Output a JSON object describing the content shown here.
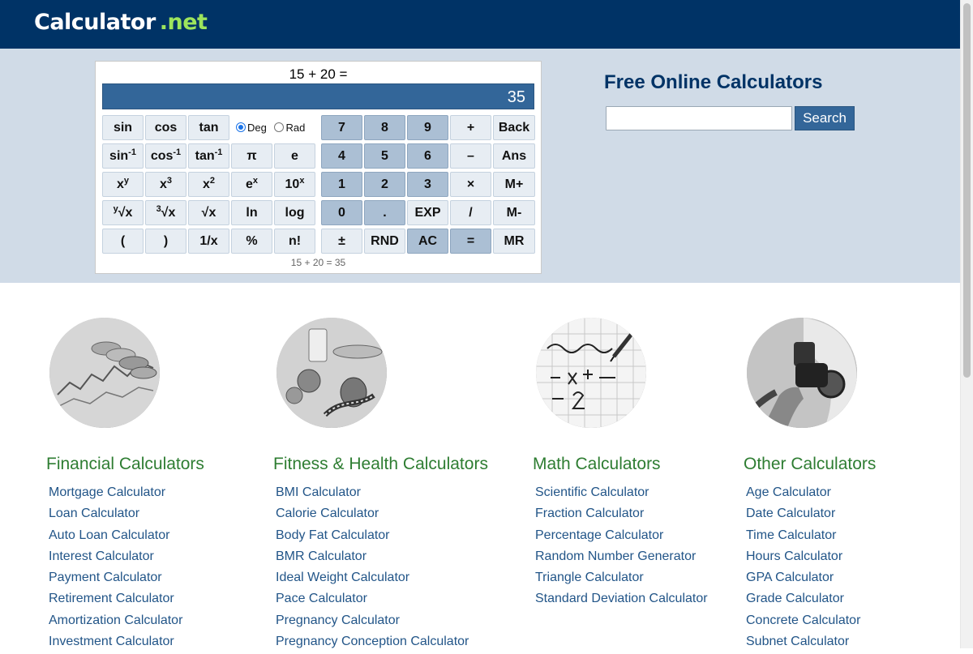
{
  "logo": {
    "main": "Calculator",
    "net": ".net"
  },
  "calculator": {
    "expression": "15 + 20 =",
    "display": "35",
    "history": "15 + 20 = 35",
    "angle": {
      "deg": "Deg",
      "rad": "Rad",
      "selected": "Deg"
    },
    "buttons": {
      "sin": "sin",
      "cos": "cos",
      "tan": "tan",
      "asin": "sin",
      "acos": "cos",
      "atan": "tan",
      "inv": "-1",
      "pi": "π",
      "e": "e",
      "x": "x",
      "y": "y",
      "three": "3",
      "two": "2",
      "ten": "10",
      "sqrt": "√",
      "xroot_x": "x",
      "cbrt_x": "x",
      "sqrt_x": "x",
      "ln": "ln",
      "log": "log",
      "lparen": "(",
      "rparen": ")",
      "recip": "1/x",
      "percent": "%",
      "fact": "n!",
      "n7": "7",
      "n8": "8",
      "n9": "9",
      "n4": "4",
      "n5": "5",
      "n6": "6",
      "n1": "1",
      "n2": "2",
      "n3": "3",
      "n0": "0",
      "dot": ".",
      "exp": "EXP",
      "plusminus": "±",
      "rnd": "RND",
      "ac": "AC",
      "plus": "+",
      "minus": "–",
      "times": "×",
      "divide": "/",
      "equals": "=",
      "back": "Back",
      "ans": "Ans",
      "mplus": "M+",
      "mminus": "M-",
      "mr": "MR"
    }
  },
  "search": {
    "title": "Free Online Calculators",
    "placeholder": "",
    "button": "Search"
  },
  "categories": [
    {
      "title": "Financial Calculators",
      "icon": "coins-chart-image",
      "links": [
        "Mortgage Calculator",
        "Loan Calculator",
        "Auto Loan Calculator",
        "Interest Calculator",
        "Payment Calculator",
        "Retirement Calculator",
        "Amortization Calculator",
        "Investment Calculator"
      ]
    },
    {
      "title": "Fitness & Health Calculators",
      "icon": "fitness-food-image",
      "links": [
        "BMI Calculator",
        "Calorie Calculator",
        "Body Fat Calculator",
        "BMR Calculator",
        "Ideal Weight Calculator",
        "Pace Calculator",
        "Pregnancy Calculator",
        "Pregnancy Conception Calculator"
      ]
    },
    {
      "title": "Math Calculators",
      "icon": "math-formula-image",
      "links": [
        "Scientific Calculator",
        "Fraction Calculator",
        "Percentage Calculator",
        "Random Number Generator",
        "Triangle Calculator",
        "Standard Deviation Calculator"
      ]
    },
    {
      "title": "Other Calculators",
      "icon": "fuel-pump-image",
      "links": [
        "Age Calculator",
        "Date Calculator",
        "Time Calculator",
        "Hours Calculator",
        "GPA Calculator",
        "Grade Calculator",
        "Concrete Calculator",
        "Subnet Calculator"
      ]
    }
  ]
}
